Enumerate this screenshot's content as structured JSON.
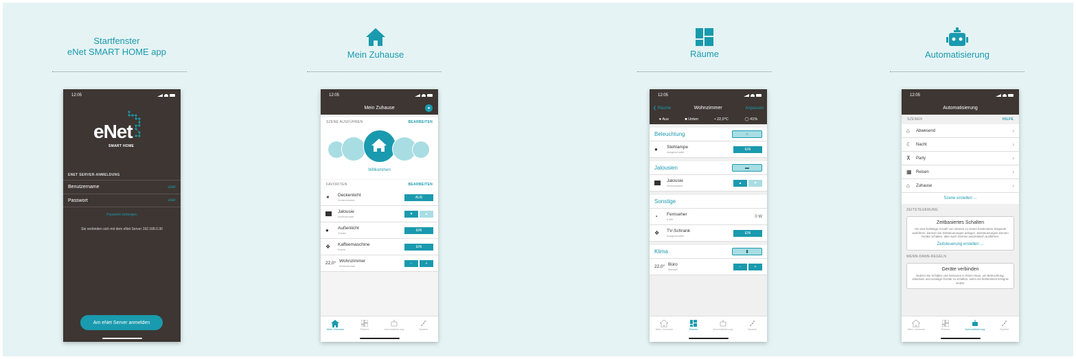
{
  "colors": {
    "accent": "#1a9aae",
    "dark": "#3d3632",
    "accent_light": "#a8dde3",
    "background": "#e5f3f4"
  },
  "columns": [
    {
      "title_line1": "Startfenster",
      "title_line2": "eNet SMART HOME app"
    },
    {
      "title": "Mein Zuhause",
      "icon": "house-icon"
    },
    {
      "title": "Räume",
      "icon": "rooms-grid-icon"
    },
    {
      "title": "Automatisierung",
      "icon": "robot-icon"
    }
  ],
  "status_time": "12:05",
  "p1": {
    "logo": "eNet",
    "logo_sub": "SMART HOME",
    "section": "ENET SERVER-ANMELDUNG",
    "fields": [
      {
        "label": "Benutzername",
        "value": "user"
      },
      {
        "label": "Passwort",
        "value": "user"
      }
    ],
    "password_link": "Passwort verbergen",
    "info": "Sie verbinden sich mit dem eNet Server 192.168.0.30",
    "login_button": "Am eNet Server anmelden"
  },
  "p2": {
    "title": "Mein Zuhause",
    "scene_header": "SZENE AUSFÜHREN",
    "scene_edit": "BEARBEITEN",
    "scene_selected": "Willkommen",
    "fav_header": "FAVORITEN",
    "fav_edit": "BEARBEITEN",
    "items": [
      {
        "name": "Deckenlicht",
        "sub": "Kinderzimmer",
        "action": "AUS"
      },
      {
        "name": "Jalousie",
        "sub": "Wohnzimmer"
      },
      {
        "name": "Außenlicht",
        "sub": "Garten",
        "action": "EIN"
      },
      {
        "name": "Kaffeemaschine",
        "sub": "Küche",
        "action": "EIN"
      },
      {
        "name": "Wohnzimmer",
        "sub": "Wohnzimmer",
        "temp": "22,0°",
        "minus": "−",
        "plus": "+"
      }
    ]
  },
  "tabs": [
    "Mein Zuhause",
    "Räume",
    "Automatisierung",
    "System"
  ],
  "p3": {
    "back": "Räume",
    "title": "Wohnzimmer",
    "edit": "Anpassen",
    "info": [
      "Aus",
      "Unten",
      "22,0°C",
      "41%"
    ],
    "groups": [
      {
        "title": "Beleuchtung",
        "items": [
          {
            "name": "Stehlampe",
            "sub": "Ausgeschaltet",
            "action": "EIN"
          }
        ]
      },
      {
        "title": "Jalousien",
        "items": [
          {
            "name": "Jalousie",
            "sub": "Geschlossen"
          }
        ]
      },
      {
        "title": "Sonstige",
        "items": [
          {
            "name": "Fernseher",
            "sub": "0 Wh",
            "value": "0 W"
          },
          {
            "name": "TV-Schrank",
            "sub": "Ausgeschaltet",
            "action": "EIN"
          }
        ]
      },
      {
        "title": "Klima",
        "items": [
          {
            "name": "Büro",
            "sub": "Manuell",
            "temp": "22,0°",
            "minus": "−",
            "plus": "+"
          }
        ]
      }
    ]
  },
  "p4": {
    "title": "Automatisierung",
    "scenes_header": "SZENEN",
    "help": "HILFE",
    "scenes": [
      "Abwesend",
      "Nacht",
      "Party",
      "Reisen",
      "Zuhause"
    ],
    "create_scene": "Szene erstellen ...",
    "time_header": "ZEITSTEUERUNG",
    "time_card": {
      "title": "Zeitbasiertes Schalten",
      "desc": "Um eine beliebige Anzahl von Aktoren zu einem bestimmten Zeitpunkt ausführen, können Sie Zeitsteuerungen anlegen. Zeitsteuerungen können Geräte schalten, aber auch Szenen automatisch ausführen.",
      "link": "Zeitsteuerung erstellen ..."
    },
    "rules_header": "WENN-DANN-REGELN",
    "rules_card": {
      "title": "Geräte verbinden",
      "desc": "Nutzen Sie Schalter und Sensoren in Ihrem Haus, um Beleuchtung, Jalousien und sonstige Geräte zu schalten, wenn ein bestimmtes Ereignis eintritt."
    }
  }
}
